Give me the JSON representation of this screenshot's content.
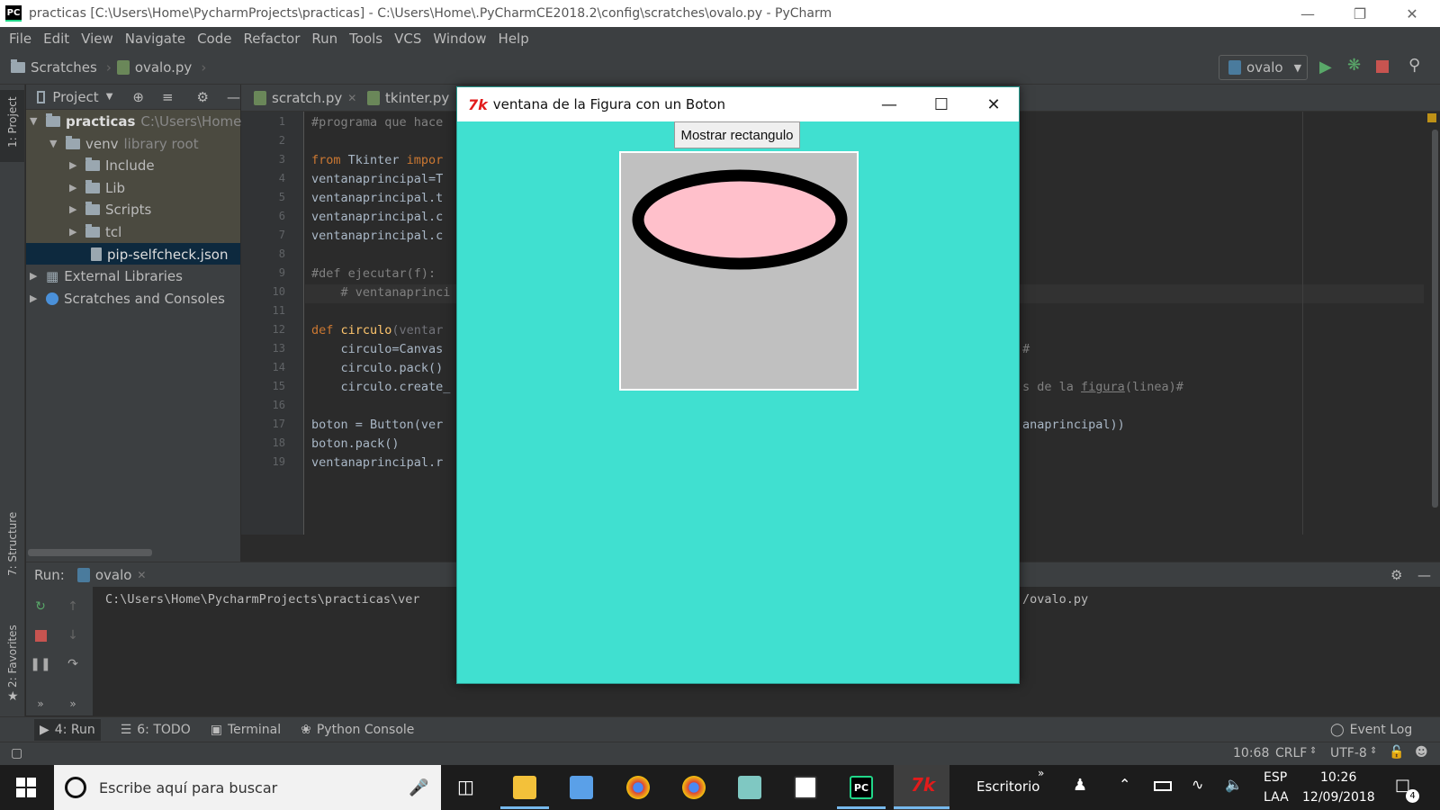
{
  "titlebar": {
    "title": "practicas [C:\\Users\\Home\\PycharmProjects\\practicas] - C:\\Users\\Home\\.PyCharmCE2018.2\\config\\scratches\\ovalo.py - PyCharm",
    "logo_text": "PC"
  },
  "menu": [
    "File",
    "Edit",
    "View",
    "Navigate",
    "Code",
    "Refactor",
    "Run",
    "Tools",
    "VCS",
    "Window",
    "Help"
  ],
  "navbar": {
    "crumbs": [
      "Scratches",
      "ovalo.py"
    ],
    "run_config": "ovalo"
  },
  "left_strip": {
    "project": "1: Project",
    "structure": "7: Structure",
    "favorites": "2: Favorites"
  },
  "project_panel": {
    "header": "Project",
    "tree": [
      {
        "label": "practicas",
        "hint": "C:\\Users\\Home\\Py"
      },
      {
        "label": "venv",
        "hint": "library root"
      },
      {
        "label": "Include"
      },
      {
        "label": "Lib"
      },
      {
        "label": "Scripts"
      },
      {
        "label": "tcl"
      },
      {
        "label": "pip-selfcheck.json"
      },
      {
        "label": "External Libraries"
      },
      {
        "label": "Scratches and Consoles"
      }
    ]
  },
  "editor": {
    "tabs": [
      "scratch.py",
      "tkinter.py"
    ],
    "line_numbers": [
      "1",
      "2",
      "3",
      "4",
      "5",
      "6",
      "7",
      "8",
      "9",
      "10",
      "11",
      "12",
      "13",
      "14",
      "15",
      "16",
      "17",
      "18",
      "19"
    ],
    "lines": {
      "l1": "#programa que hace",
      "l3a": "from",
      "l3b": " Tkinter ",
      "l3c": "impor",
      "l4": "ventanaprincipal=T",
      "l5": "ventanaprincipal.t",
      "l6": "ventanaprincipal.c",
      "l7": "ventanaprincipal.c",
      "l9": "#def ejecutar(f):",
      "l10": "    # ventanaprinci",
      "l12a": "def",
      "l12b": " circulo",
      "l12c": "(ventar",
      "l13": "    circulo=Canvas",
      "l14": "    circulo.pack()",
      "l15": "    circulo.create_",
      "l17": "boton = Button(ver",
      "l18": "boton.pack()",
      "l19": "ventanaprincipal.r",
      "r13": "#",
      "r15a": "s de la ",
      "r15b": "figura",
      "r15c": "(linea)#",
      "r17": "anaprincipal))"
    }
  },
  "run_panel": {
    "label": "Run:",
    "tab": "ovalo",
    "output_left": "C:\\Users\\Home\\PycharmProjects\\practicas\\ver",
    "output_right": "/ovalo.py"
  },
  "bottom_tools": [
    "4: Run",
    "6: TODO",
    "Terminal",
    "Python Console"
  ],
  "event_log": "Event Log",
  "status": {
    "position": "10:68",
    "line_sep": "CRLF",
    "encoding": "UTF-8"
  },
  "tk_window": {
    "title": "ventana de la Figura con un Boton",
    "button_label": "Mostrar rectangulo",
    "bg_color": "#40e0d0",
    "canvas_color": "#c0c0c0",
    "oval_fill": "#ffc0cb",
    "oval_outline": "#000000"
  },
  "taskbar": {
    "search_placeholder": "Escribe aquí para buscar",
    "desktop_label": "Escritorio",
    "lang_top": "ESP",
    "lang_bottom": "LAA",
    "time": "10:26",
    "date": "12/09/2018",
    "notif_count": "4"
  }
}
